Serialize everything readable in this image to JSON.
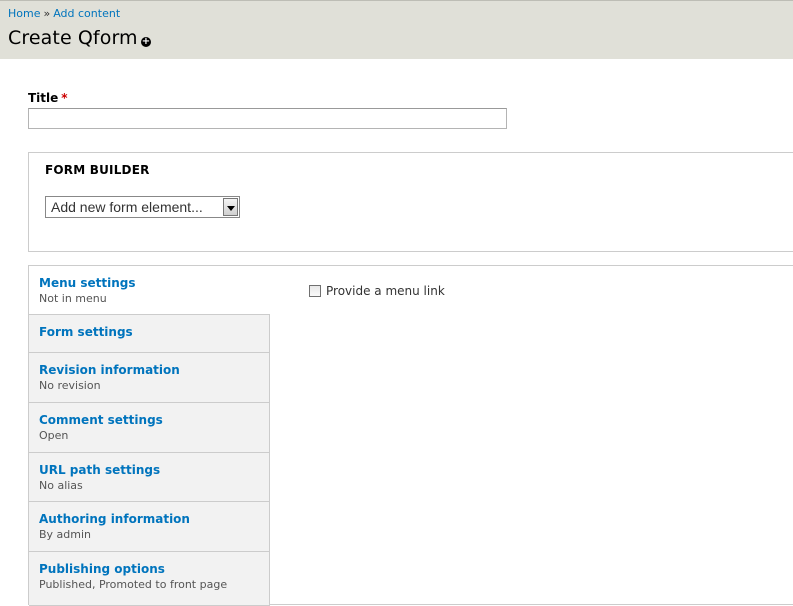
{
  "breadcrumb": {
    "home": "Home",
    "separator": "»",
    "add_content": "Add content"
  },
  "page_title": "Create Qform",
  "shortcut_icon": "plus-circle-icon",
  "title_field": {
    "label": "Title",
    "required_mark": "*",
    "value": ""
  },
  "form_builder": {
    "legend": "FORM BUILDER",
    "select_value": "Add new form element..."
  },
  "vertical_tabs": [
    {
      "label": "Menu settings",
      "summary": "Not in menu"
    },
    {
      "label": "Form settings",
      "summary": ""
    },
    {
      "label": "Revision information",
      "summary": "No revision"
    },
    {
      "label": "Comment settings",
      "summary": "Open"
    },
    {
      "label": "URL path settings",
      "summary": "No alias"
    },
    {
      "label": "Authoring information",
      "summary": "By admin"
    },
    {
      "label": "Publishing options",
      "summary": "Published, Promoted to front page"
    }
  ],
  "menu_pane": {
    "checkbox_label": "Provide a menu link",
    "checked": false
  },
  "colors": {
    "link": "#0074bd",
    "header_bg": "#e0e0d8",
    "tab_bg": "#f2f2f2",
    "required": "#cc0000"
  }
}
